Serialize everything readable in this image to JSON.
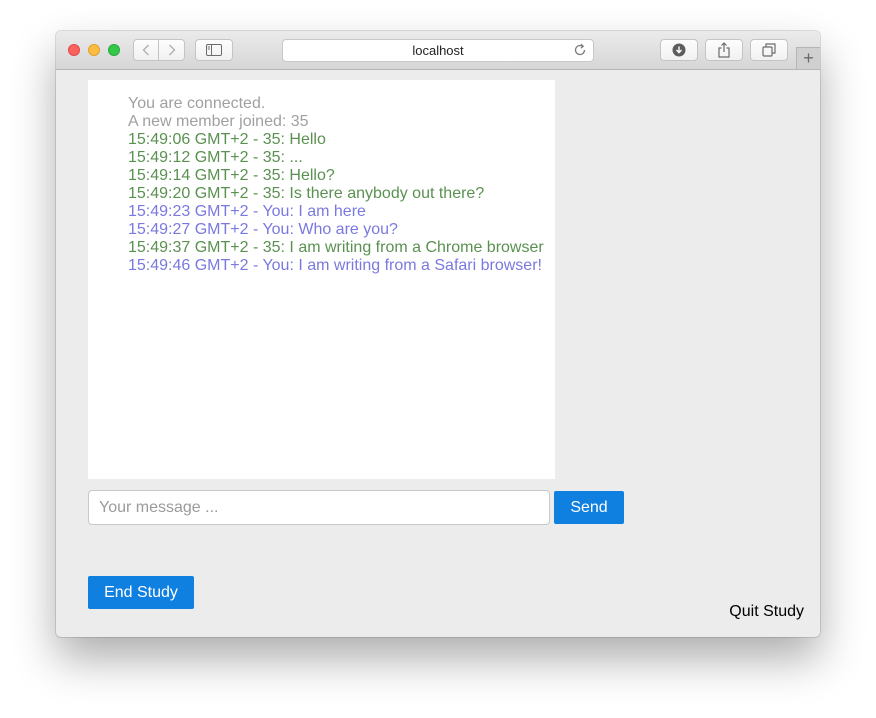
{
  "browser": {
    "address": "localhost",
    "icons": {
      "back": "chevron-left-icon",
      "forward": "chevron-right-icon",
      "sidebar": "sidebar-icon",
      "reload": "reload-icon",
      "downloads": "download-icon",
      "share": "share-icon",
      "tabs": "tabs-icon",
      "new_tab": "plus-icon"
    },
    "new_tab_glyph": "+"
  },
  "chat": {
    "messages": [
      {
        "kind": "system",
        "text": "You are connected."
      },
      {
        "kind": "system",
        "text": "A new member joined: 35"
      },
      {
        "kind": "other",
        "text": "15:49:06 GMT+2 - 35: Hello"
      },
      {
        "kind": "other",
        "text": "15:49:12 GMT+2 - 35: ..."
      },
      {
        "kind": "other",
        "text": "15:49:14 GMT+2 - 35: Hello?"
      },
      {
        "kind": "other",
        "text": "15:49:20 GMT+2 - 35: Is there anybody out there?"
      },
      {
        "kind": "self",
        "text": "15:49:23 GMT+2 - You: I am here"
      },
      {
        "kind": "self",
        "text": "15:49:27 GMT+2 - You: Who are you?"
      },
      {
        "kind": "other",
        "text": "15:49:37 GMT+2 - 35: I am writing from a Chrome browser"
      },
      {
        "kind": "self",
        "text": "15:49:46 GMT+2 - You: I am writing from a Safari browser!"
      }
    ],
    "input": {
      "value": "",
      "placeholder": "Your message ..."
    },
    "send_label": "Send"
  },
  "study": {
    "end_label": "End Study",
    "quit_label": "Quit Study"
  },
  "colors": {
    "system": "#a0a0a0",
    "other": "#5a9150",
    "self": "#7a79df",
    "accent": "#0f7fe0"
  }
}
